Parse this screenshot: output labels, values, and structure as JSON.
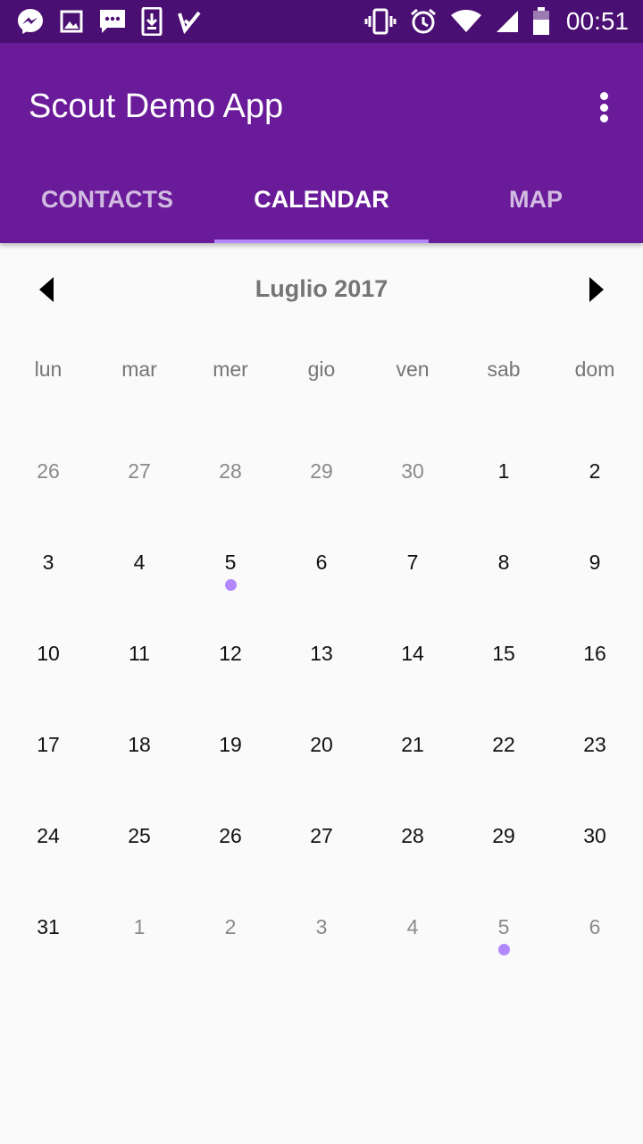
{
  "status_bar": {
    "time": "00:51",
    "left_icons": [
      "messenger-icon",
      "image-icon",
      "chat-icon",
      "download-icon",
      "tasks-icon"
    ],
    "right_icons": [
      "vibrate-icon",
      "alarm-icon",
      "wifi-icon",
      "signal-icon",
      "battery-icon"
    ]
  },
  "app_bar": {
    "title": "Scout Demo App",
    "overflow_icon": "more-vert-icon",
    "color": "#6a1b9a"
  },
  "tabs": [
    {
      "label": "CONTACTS",
      "active": false
    },
    {
      "label": "CALENDAR",
      "active": true
    },
    {
      "label": "MAP",
      "active": false
    }
  ],
  "calendar": {
    "month_title": "Luglio 2017",
    "weekdays": [
      "lun",
      "mar",
      "mer",
      "gio",
      "ven",
      "sab",
      "dom"
    ],
    "event_color": "#b388ff",
    "weeks": [
      [
        {
          "d": "26",
          "o": true
        },
        {
          "d": "27",
          "o": true
        },
        {
          "d": "28",
          "o": true
        },
        {
          "d": "29",
          "o": true
        },
        {
          "d": "30",
          "o": true
        },
        {
          "d": "1"
        },
        {
          "d": "2"
        }
      ],
      [
        {
          "d": "3"
        },
        {
          "d": "4"
        },
        {
          "d": "5",
          "e": true
        },
        {
          "d": "6"
        },
        {
          "d": "7"
        },
        {
          "d": "8"
        },
        {
          "d": "9"
        }
      ],
      [
        {
          "d": "10"
        },
        {
          "d": "11"
        },
        {
          "d": "12"
        },
        {
          "d": "13"
        },
        {
          "d": "14"
        },
        {
          "d": "15"
        },
        {
          "d": "16"
        }
      ],
      [
        {
          "d": "17"
        },
        {
          "d": "18"
        },
        {
          "d": "19"
        },
        {
          "d": "20"
        },
        {
          "d": "21"
        },
        {
          "d": "22"
        },
        {
          "d": "23"
        }
      ],
      [
        {
          "d": "24"
        },
        {
          "d": "25"
        },
        {
          "d": "26"
        },
        {
          "d": "27"
        },
        {
          "d": "28"
        },
        {
          "d": "29"
        },
        {
          "d": "30"
        }
      ],
      [
        {
          "d": "31"
        },
        {
          "d": "1",
          "o": true
        },
        {
          "d": "2",
          "o": true
        },
        {
          "d": "3",
          "o": true
        },
        {
          "d": "4",
          "o": true
        },
        {
          "d": "5",
          "o": true,
          "e": true
        },
        {
          "d": "6",
          "o": true
        }
      ]
    ]
  }
}
